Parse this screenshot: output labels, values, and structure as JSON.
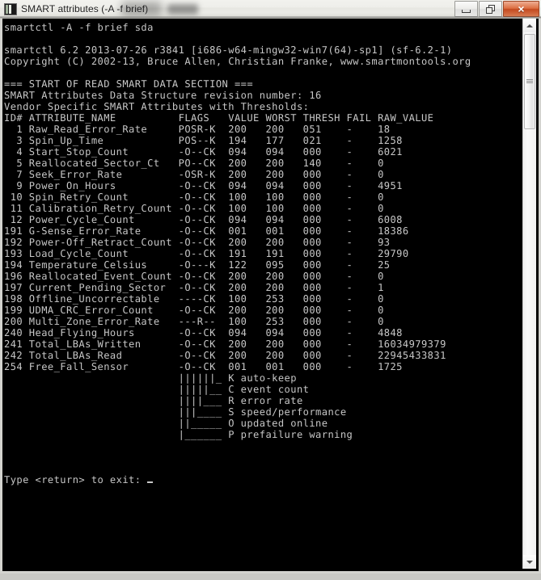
{
  "window": {
    "title": "SMART attributes (-A -f brief)",
    "icon": "console-icon",
    "buttons": {
      "minimize": "minimize-button",
      "maximize": "restore-button",
      "close": "×"
    }
  },
  "scrollbar": {
    "up_arrow": "scroll-up-arrow",
    "down_arrow": "scroll-down-arrow",
    "thumb": "scroll-thumb"
  },
  "terminal": {
    "command_line": "smartctl -A -f brief sda",
    "version_line": "smartctl 6.2 2013-07-26 r3841 [i686-w64-mingw32-win7(64)-sp1] (sf-6.2-1)",
    "copyright_line": "Copyright (C) 2002-13, Bruce Allen, Christian Franke, www.smartmontools.org",
    "section_header": "=== START OF READ SMART DATA SECTION ===",
    "revision_line": "SMART Attributes Data Structure revision number: 16",
    "vendor_line": "Vendor Specific SMART Attributes with Thresholds:",
    "table_header": "ID# ATTRIBUTE_NAME          FLAGS    VALUE WORST THRESH FAIL RAW_VALUE",
    "columns": [
      "ID#",
      "ATTRIBUTE_NAME",
      "FLAGS",
      "VALUE",
      "WORST",
      "THRESH",
      "FAIL",
      "RAW_VALUE"
    ],
    "rows": [
      {
        "id": "1",
        "name": "Raw_Read_Error_Rate",
        "flags": "POSR-K",
        "value": "200",
        "worst": "200",
        "thresh": "051",
        "fail": "-",
        "raw": "18"
      },
      {
        "id": "3",
        "name": "Spin_Up_Time",
        "flags": "POS--K",
        "value": "194",
        "worst": "177",
        "thresh": "021",
        "fail": "-",
        "raw": "1258"
      },
      {
        "id": "4",
        "name": "Start_Stop_Count",
        "flags": "-O--CK",
        "value": "094",
        "worst": "094",
        "thresh": "000",
        "fail": "-",
        "raw": "6021"
      },
      {
        "id": "5",
        "name": "Reallocated_Sector_Ct",
        "flags": "PO--CK",
        "value": "200",
        "worst": "200",
        "thresh": "140",
        "fail": "-",
        "raw": "0"
      },
      {
        "id": "7",
        "name": "Seek_Error_Rate",
        "flags": "-OSR-K",
        "value": "200",
        "worst": "200",
        "thresh": "000",
        "fail": "-",
        "raw": "0"
      },
      {
        "id": "9",
        "name": "Power_On_Hours",
        "flags": "-O--CK",
        "value": "094",
        "worst": "094",
        "thresh": "000",
        "fail": "-",
        "raw": "4951"
      },
      {
        "id": "10",
        "name": "Spin_Retry_Count",
        "flags": "-O--CK",
        "value": "100",
        "worst": "100",
        "thresh": "000",
        "fail": "-",
        "raw": "0"
      },
      {
        "id": "11",
        "name": "Calibration_Retry_Count",
        "flags": "-O--CK",
        "value": "100",
        "worst": "100",
        "thresh": "000",
        "fail": "-",
        "raw": "0"
      },
      {
        "id": "12",
        "name": "Power_Cycle_Count",
        "flags": "-O--CK",
        "value": "094",
        "worst": "094",
        "thresh": "000",
        "fail": "-",
        "raw": "6008"
      },
      {
        "id": "191",
        "name": "G-Sense_Error_Rate",
        "flags": "-O--CK",
        "value": "001",
        "worst": "001",
        "thresh": "000",
        "fail": "-",
        "raw": "18386"
      },
      {
        "id": "192",
        "name": "Power-Off_Retract_Count",
        "flags": "-O--CK",
        "value": "200",
        "worst": "200",
        "thresh": "000",
        "fail": "-",
        "raw": "93"
      },
      {
        "id": "193",
        "name": "Load_Cycle_Count",
        "flags": "-O--CK",
        "value": "191",
        "worst": "191",
        "thresh": "000",
        "fail": "-",
        "raw": "29790"
      },
      {
        "id": "194",
        "name": "Temperature_Celsius",
        "flags": "-O---K",
        "value": "122",
        "worst": "095",
        "thresh": "000",
        "fail": "-",
        "raw": "25"
      },
      {
        "id": "196",
        "name": "Reallocated_Event_Count",
        "flags": "-O--CK",
        "value": "200",
        "worst": "200",
        "thresh": "000",
        "fail": "-",
        "raw": "0"
      },
      {
        "id": "197",
        "name": "Current_Pending_Sector",
        "flags": "-O--CK",
        "value": "200",
        "worst": "200",
        "thresh": "000",
        "fail": "-",
        "raw": "1"
      },
      {
        "id": "198",
        "name": "Offline_Uncorrectable",
        "flags": "----CK",
        "value": "100",
        "worst": "253",
        "thresh": "000",
        "fail": "-",
        "raw": "0"
      },
      {
        "id": "199",
        "name": "UDMA_CRC_Error_Count",
        "flags": "-O--CK",
        "value": "200",
        "worst": "200",
        "thresh": "000",
        "fail": "-",
        "raw": "0"
      },
      {
        "id": "200",
        "name": "Multi_Zone_Error_Rate",
        "flags": "---R--",
        "value": "100",
        "worst": "253",
        "thresh": "000",
        "fail": "-",
        "raw": "0"
      },
      {
        "id": "240",
        "name": "Head_Flying_Hours",
        "flags": "-O--CK",
        "value": "094",
        "worst": "094",
        "thresh": "000",
        "fail": "-",
        "raw": "4848"
      },
      {
        "id": "241",
        "name": "Total_LBAs_Written",
        "flags": "-O--CK",
        "value": "200",
        "worst": "200",
        "thresh": "000",
        "fail": "-",
        "raw": "16034979379"
      },
      {
        "id": "242",
        "name": "Total_LBAs_Read",
        "flags": "-O--CK",
        "value": "200",
        "worst": "200",
        "thresh": "000",
        "fail": "-",
        "raw": "22945433831"
      },
      {
        "id": "254",
        "name": "Free_Fall_Sensor",
        "flags": "-O--CK",
        "value": "001",
        "worst": "001",
        "thresh": "000",
        "fail": "-",
        "raw": "1725"
      }
    ],
    "legend": [
      {
        "bars": "||||||_",
        "code": "K",
        "text": "auto-keep"
      },
      {
        "bars": "|||||__",
        "code": "C",
        "text": "event count"
      },
      {
        "bars": "||||___",
        "code": "R",
        "text": "error rate"
      },
      {
        "bars": "|||____",
        "code": "S",
        "text": "speed/performance"
      },
      {
        "bars": "||_____",
        "code": "O",
        "text": "updated online"
      },
      {
        "bars": "|______",
        "code": "P",
        "text": "prefailure warning"
      }
    ],
    "exit_prompt": "Type <return> to exit: ",
    "cursor": "_"
  },
  "colors": {
    "terminal_background": "#000000",
    "terminal_text": "#c8c8c8",
    "window_chrome": "#d3d3cf",
    "close_button": "#c34a20",
    "desktop": "#c9c9c5"
  }
}
